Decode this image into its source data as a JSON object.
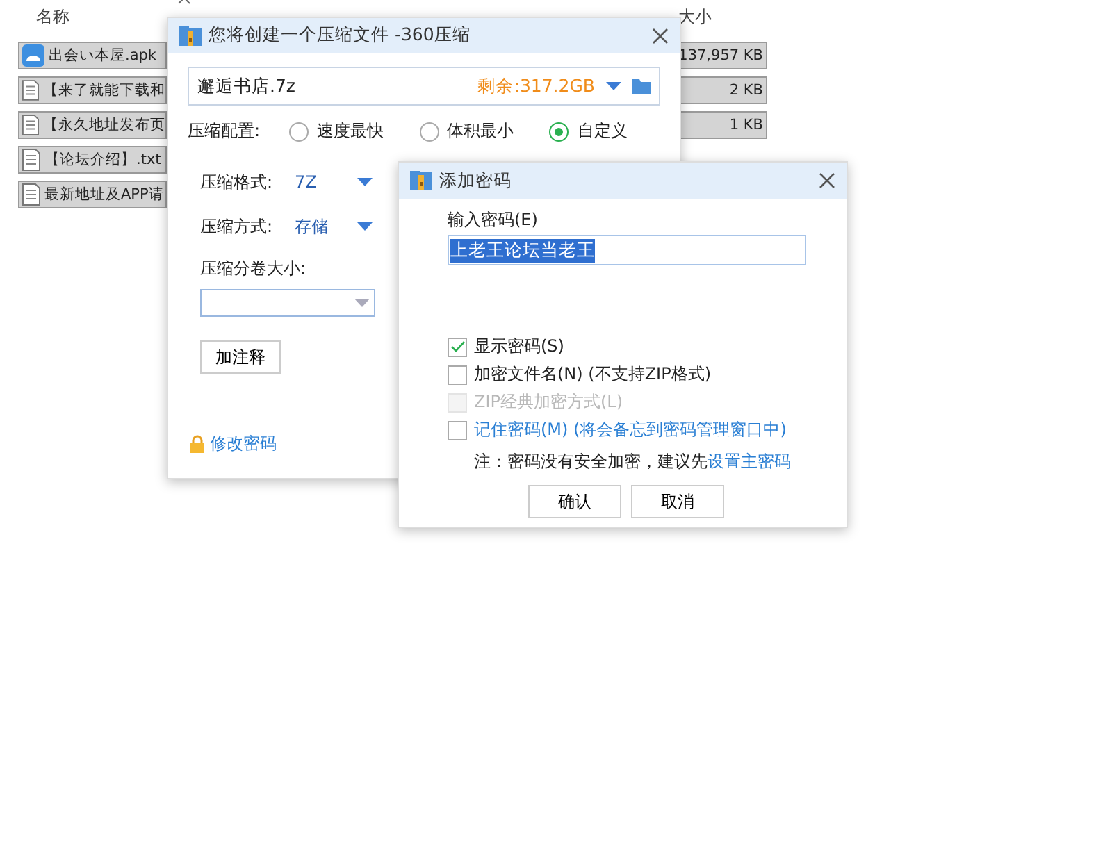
{
  "explorer": {
    "columns": [
      {
        "label": "名称"
      },
      {
        "label": "大小"
      }
    ],
    "files": [
      {
        "name": "出会い本屋.apk",
        "kind": "apk",
        "size": "137,957 KB",
        "selected": true
      },
      {
        "name": "【来了就能下载和",
        "kind": "text",
        "size": "2 KB",
        "selected": true
      },
      {
        "name": "【永久地址发布页",
        "kind": "text",
        "size": "1 KB",
        "selected": true
      },
      {
        "name": "【论坛介绍】.txt",
        "kind": "text",
        "selected": true
      },
      {
        "name": "最新地址及APP请",
        "kind": "text",
        "selected": true
      }
    ]
  },
  "compress_dialog": {
    "title": "您将创建一个压缩文件 -360压缩",
    "filename": "邂逅书店.7z",
    "free_space": "剩余:317.2GB",
    "profile_label": "压缩配置:",
    "profiles": [
      {
        "label": "速度最快",
        "selected": false
      },
      {
        "label": "体积最小",
        "selected": false
      },
      {
        "label": "自定义",
        "selected": true
      }
    ],
    "settings": [
      {
        "label": "压缩格式:",
        "value": "7Z"
      },
      {
        "label": "压缩方式:",
        "value": "存储"
      }
    ],
    "volume_label": "压缩分卷大小:",
    "comment_button": "加注释",
    "change_password_link": "修改密码"
  },
  "password_dialog": {
    "title": "添加密码",
    "input_label": "输入密码(E)",
    "password": "上老王论坛当老王",
    "options": [
      {
        "label": "显示密码(S)",
        "kind": "plain",
        "checked": true,
        "disabled": false
      },
      {
        "label": "加密文件名(N) (不支持ZIP格式)",
        "kind": "plain",
        "checked": false,
        "disabled": false
      },
      {
        "label": "ZIP经典加密方式(L)",
        "kind": "plain",
        "checked": false,
        "disabled": true
      },
      {
        "label": "记住密码(M) (将会备忘到密码管理窗口中)",
        "kind": "link",
        "checked": false,
        "disabled": false
      }
    ],
    "note": "注：密码没有安全加密，建议先",
    "note_link": "设置主密码",
    "buttons": [
      "确认",
      "取消"
    ]
  }
}
